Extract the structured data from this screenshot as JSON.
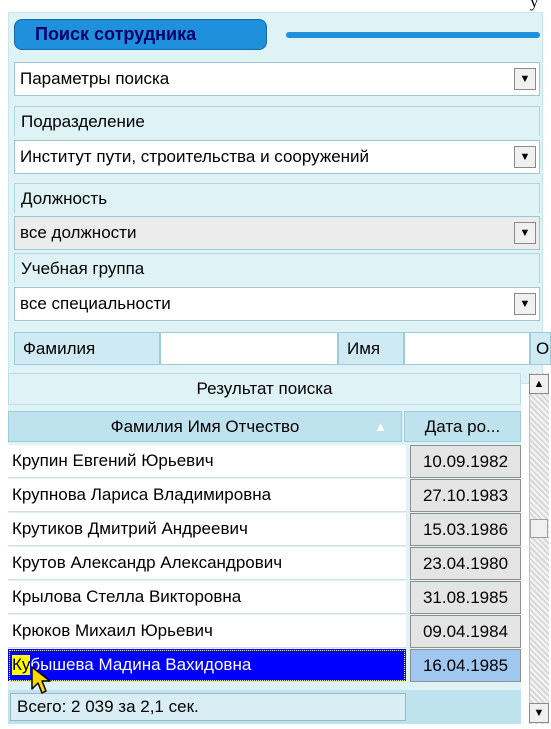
{
  "top_fragment": "у",
  "title": "Поиск сотрудника",
  "search_params": {
    "value": "Параметры поиска"
  },
  "department": {
    "label": "Подразделение",
    "value": "Институт пути, строительства и сооружений"
  },
  "position": {
    "label": "Должность",
    "value": "все должности"
  },
  "study_group": {
    "label": "Учебная группа",
    "value": "все специальности"
  },
  "name_filters": {
    "surname_label": "Фамилия",
    "firstname_label": "Имя",
    "patronymic_label_fragment": "О"
  },
  "results": {
    "title": "Результат поиска",
    "columns": {
      "fio": "Фамилия Имя Отчество",
      "birth": "Дата ро..."
    },
    "sort_indicator": "▲",
    "rows": [
      {
        "name": "Крупин Евгений Юрьевич",
        "date": "10.09.1982"
      },
      {
        "name": "Крупнова Лариса Владимировна",
        "date": "27.10.1983"
      },
      {
        "name": "Крутиков Дмитрий Андреевич",
        "date": "15.03.1986"
      },
      {
        "name": "Крутов Александр Александрович",
        "date": "23.04.1980"
      },
      {
        "name": "Крылова Стелла Викторовна",
        "date": "31.08.1985"
      },
      {
        "name": "Крюков Михаил Юрьевич",
        "date": "09.04.1984"
      },
      {
        "name_highlight": "Ку",
        "name_rest": "бышева Мадина Вахидовна",
        "date": "16.04.1985",
        "selected": true
      }
    ],
    "status": "Всего: 2 039 за 2,1 сек."
  },
  "icons": {
    "dropdown": "▼",
    "scroll_up": "▲",
    "scroll_down": "▼"
  },
  "colors": {
    "accent": "#1e90dc",
    "title_text": "#00006a",
    "panel_bg": "#dff3f7",
    "selection": "#0000ff",
    "highlight": "#ffff00"
  }
}
